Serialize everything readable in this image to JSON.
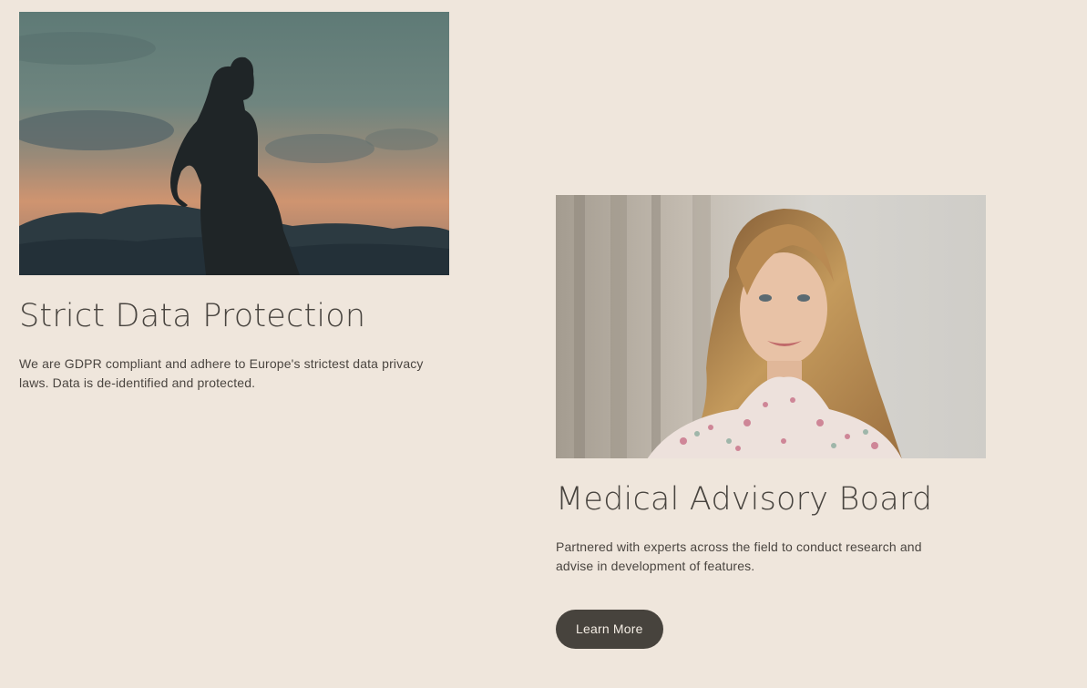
{
  "features": [
    {
      "title": "Strict Data Protection",
      "description": "We are GDPR compliant and adhere to Europe's strictest data privacy laws. Data is de-identified and protected."
    },
    {
      "title": "Medical Advisory Board",
      "description": "Partnered with experts across the field to conduct research and advise in development of features.",
      "button_label": "Learn More"
    }
  ],
  "colors": {
    "background": "#efe6dc",
    "text": "#46423e",
    "button_bg": "#47433d",
    "button_text": "#f4ede4"
  }
}
